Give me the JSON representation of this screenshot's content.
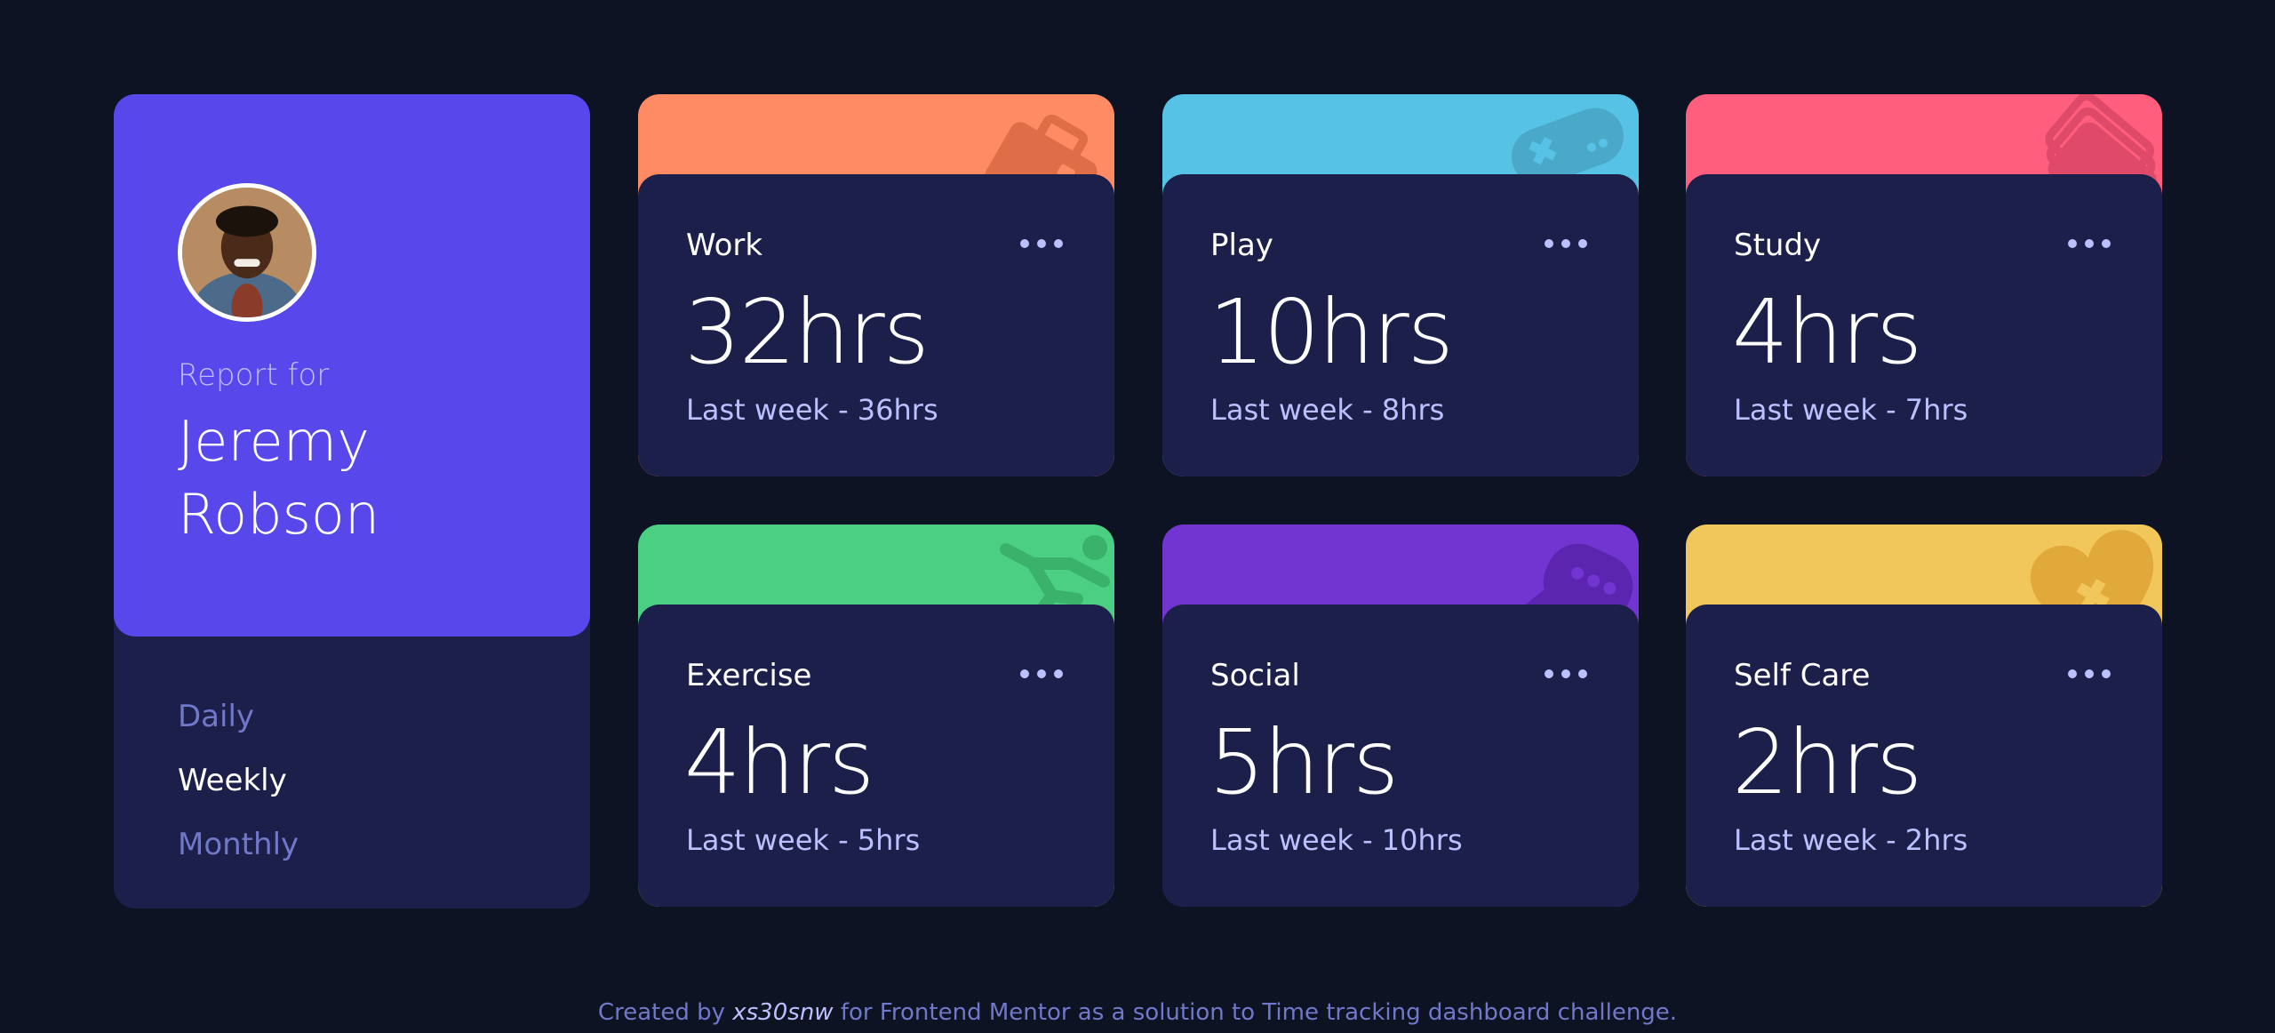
{
  "profile": {
    "report_label": "Report for",
    "first_name": "Jeremy",
    "last_name": "Robson",
    "accent_color": "#5847eb",
    "periods": [
      {
        "label": "Daily",
        "active": false
      },
      {
        "label": "Weekly",
        "active": true
      },
      {
        "label": "Monthly",
        "active": false
      }
    ]
  },
  "activities": [
    {
      "title": "Work",
      "current": "32hrs",
      "previous": "Last week - 36hrs",
      "color": "#ff8b64",
      "icon": "briefcase-icon"
    },
    {
      "title": "Play",
      "current": "10hrs",
      "previous": "Last week - 8hrs",
      "color": "#55c2e6",
      "icon": "gamepad-icon"
    },
    {
      "title": "Study",
      "current": "4hrs",
      "previous": "Last week - 7hrs",
      "color": "#ff5e7d",
      "icon": "books-icon"
    },
    {
      "title": "Exercise",
      "current": "4hrs",
      "previous": "Last week - 5hrs",
      "color": "#4bcf82",
      "icon": "runner-icon"
    },
    {
      "title": "Social",
      "current": "5hrs",
      "previous": "Last week - 10hrs",
      "color": "#7335d2",
      "icon": "speech-bubble-icon"
    },
    {
      "title": "Self Care",
      "current": "2hrs",
      "previous": "Last week - 2hrs",
      "color": "#f1c65b",
      "icon": "heart-icon"
    }
  ],
  "footer": {
    "prefix": "Created by ",
    "author": "xs30snw",
    "suffix": " for Frontend Mentor as a solution to Time tracking dashboard challenge."
  }
}
